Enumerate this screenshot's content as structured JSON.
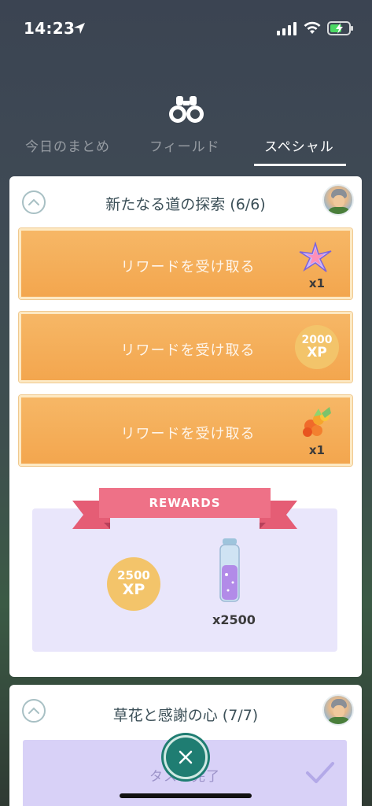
{
  "status_bar": {
    "time": "14:23",
    "icons": [
      "location-arrow-icon",
      "signal-icon",
      "wifi-icon",
      "battery-charging-icon"
    ]
  },
  "header": {
    "icon": "binoculars-icon",
    "tabs": [
      {
        "label": "今日のまとめ",
        "active": false
      },
      {
        "label": "フィールド",
        "active": false
      },
      {
        "label": "スペシャル",
        "active": true
      }
    ]
  },
  "research_card": {
    "title": "新たなる道の探索 (6/6)",
    "rewards": [
      {
        "label": "リワードを受け取る",
        "item_icon": "star-piece-icon",
        "qty": "x1"
      },
      {
        "label": "リワードを受け取る",
        "xp_num": "2000",
        "xp_unit": "XP"
      },
      {
        "label": "リワードを受け取る",
        "item_icon": "incense-flower-icon",
        "qty": "x1"
      }
    ],
    "rewards_banner": "REWARDS",
    "final_rewards": {
      "xp_num": "2500",
      "xp_unit": "XP",
      "item_icon": "stardust-vial-icon",
      "item_qty": "x2500"
    }
  },
  "second_card": {
    "title": "草花と感謝の心 (7/7)",
    "task_label": "タスク完了"
  },
  "colors": {
    "reward_orange": "#f3a64e",
    "ribbon_pink": "#ee7187",
    "panel_lavender": "#e9e6fb",
    "xp_gold": "#f3c46a",
    "close_teal": "#1f7d72"
  }
}
